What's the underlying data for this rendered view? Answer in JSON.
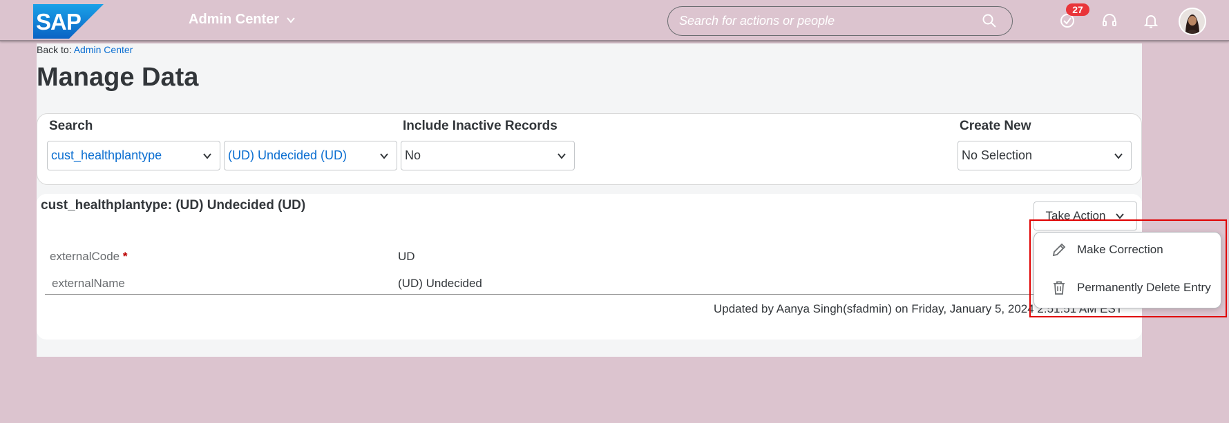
{
  "header": {
    "logo_text": "SAP",
    "app_title": "Admin Center",
    "search_placeholder": "Search for actions or people",
    "notification_count": "27",
    "icons": [
      "search-icon",
      "todo-check-icon",
      "headset-icon",
      "bell-icon",
      "user-avatar"
    ]
  },
  "breadcrumb": {
    "prefix": "Back to:",
    "link": "Admin Center"
  },
  "page_title": "Manage Data",
  "filters": {
    "search_label": "Search",
    "object_type_value": "cust_healthplantype",
    "record_value": "(UD) Undecided (UD)",
    "inactive_label": "Include Inactive Records",
    "inactive_value": "No",
    "create_label": "Create New",
    "create_value": "No Selection"
  },
  "record": {
    "title": "cust_healthplantype: (UD) Undecided (UD)",
    "take_action_label": "Take Action",
    "fields": [
      {
        "label": "externalCode",
        "required_mark": "*",
        "value": "UD"
      },
      {
        "label": "externalName",
        "value": "(UD) Undecided"
      }
    ],
    "updated_text": "Updated by Aanya Singh(sfadmin) on Friday, January 5, 2024 2:51:51 AM EST"
  },
  "action_menu": {
    "items": [
      {
        "label": "Make Correction",
        "icon": "pencil-icon"
      },
      {
        "label": "Permanently Delete Entry",
        "icon": "trash-icon"
      }
    ]
  },
  "colors": {
    "shell_bg": "#dcc4cf",
    "link": "#0a6ed1",
    "badge": "#e9353a",
    "highlight": "#e00000"
  }
}
